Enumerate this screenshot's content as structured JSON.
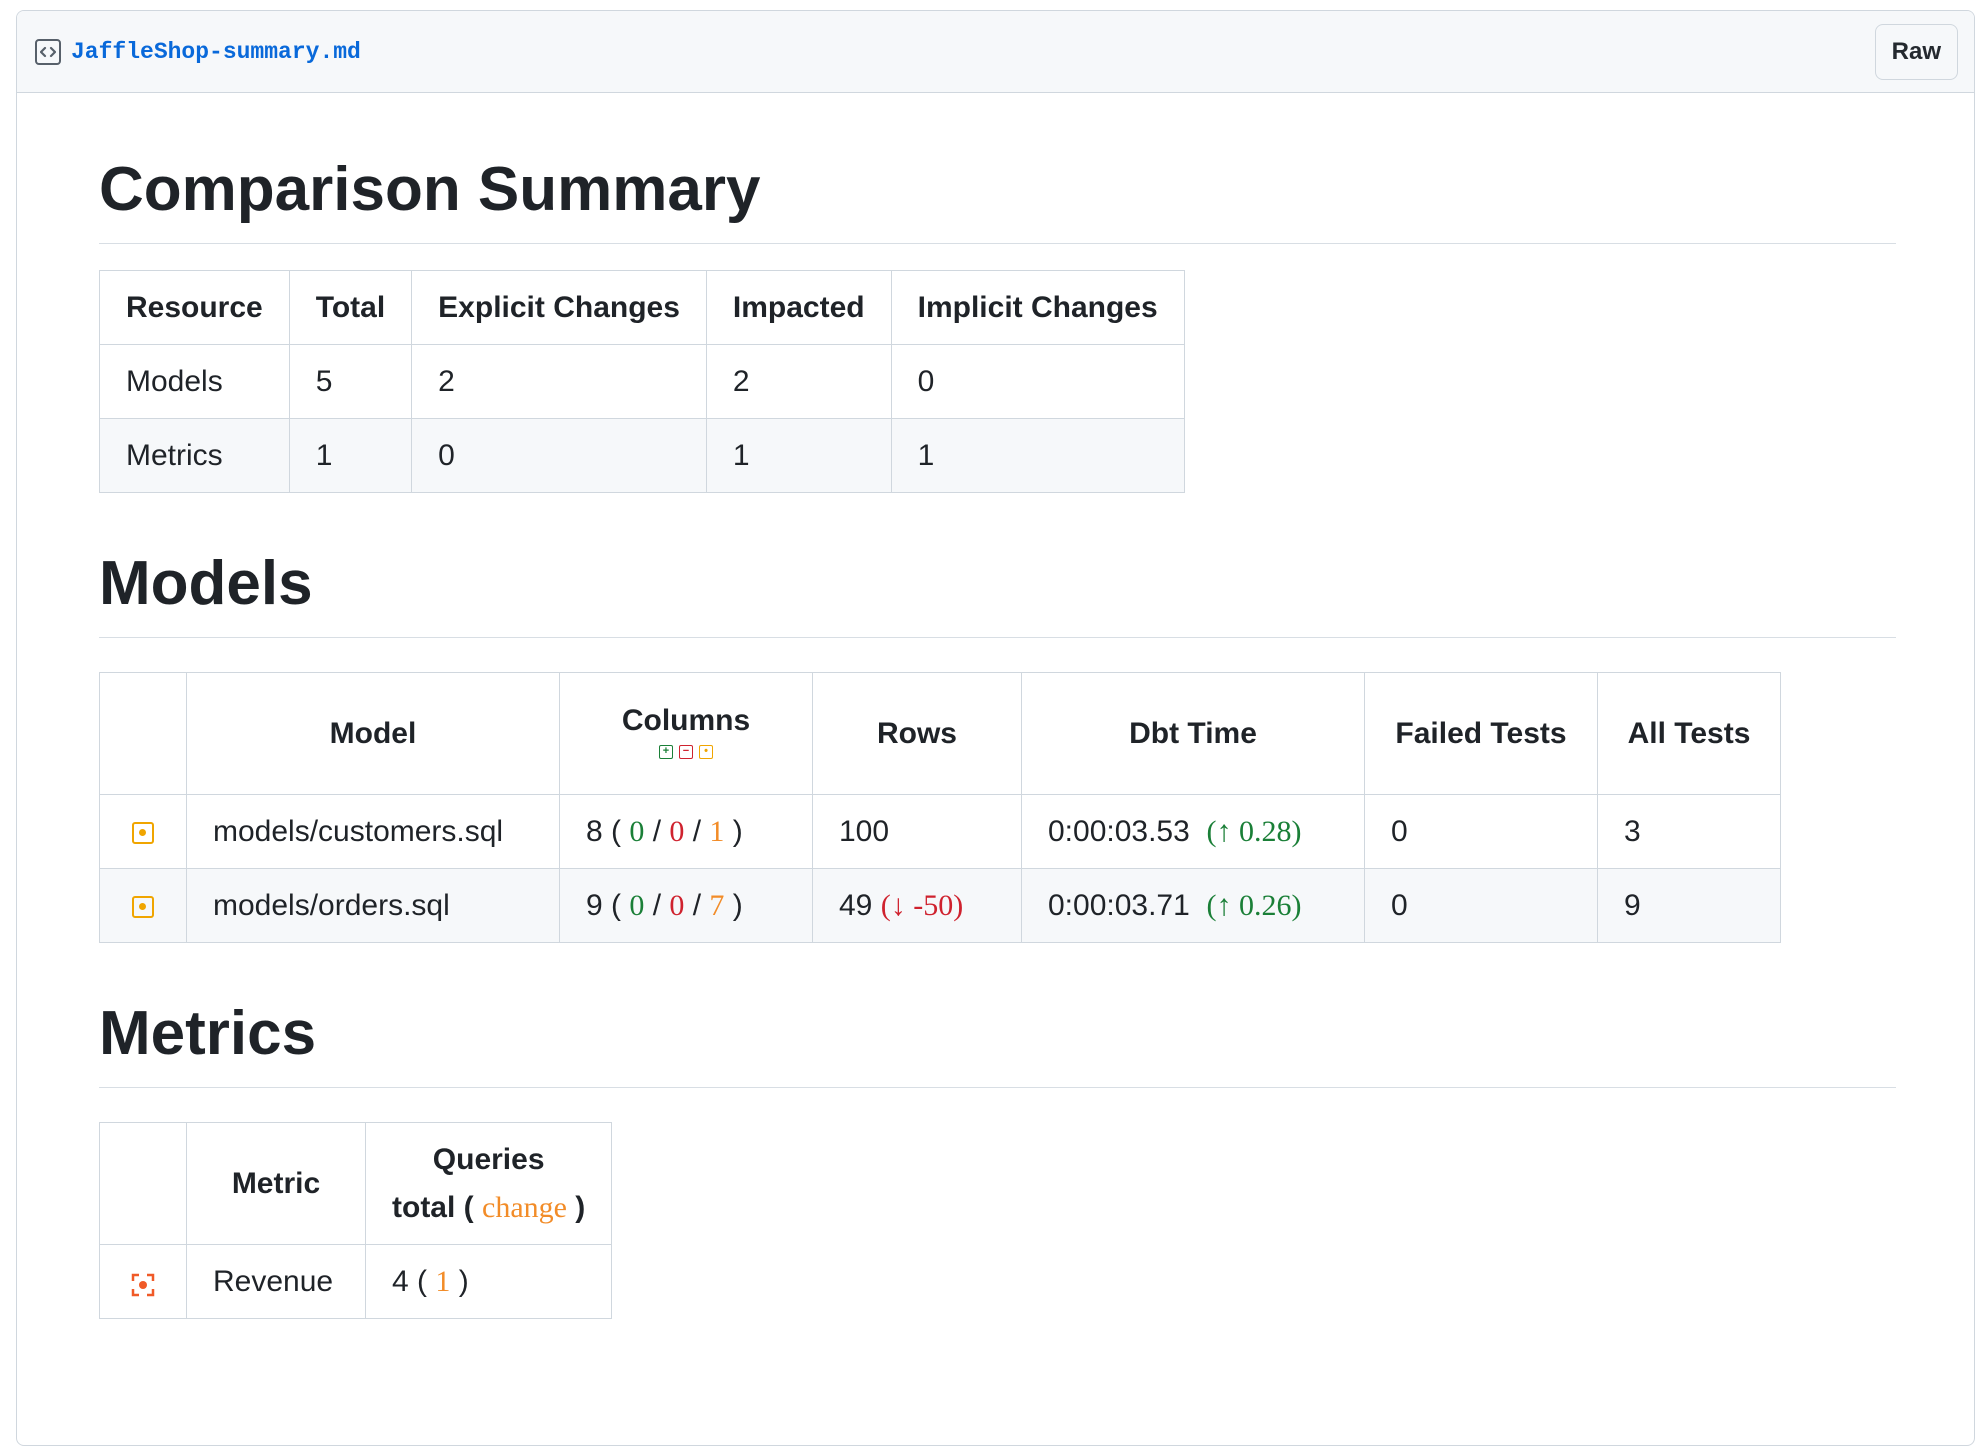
{
  "file": {
    "filename": "JaffleShop-summary.md",
    "raw_label": "Raw"
  },
  "summary": {
    "title": "Comparison Summary",
    "headers": [
      "Resource",
      "Total",
      "Explicit Changes",
      "Impacted",
      "Implicit Changes"
    ],
    "rows": [
      [
        "Models",
        "5",
        "2",
        "2",
        "0"
      ],
      [
        "Metrics",
        "1",
        "0",
        "1",
        "1"
      ]
    ]
  },
  "models": {
    "title": "Models",
    "headers": {
      "model": "Model",
      "columns": "Columns",
      "rows": "Rows",
      "dbt_time": "Dbt Time",
      "failed_tests": "Failed Tests",
      "all_tests": "All Tests"
    },
    "column_legend_icons": [
      "added-icon",
      "removed-icon",
      "changed-icon"
    ],
    "rows": [
      {
        "status_icon": "changed-icon",
        "model": "models/customers.sql",
        "columns_total": "8",
        "added": "0",
        "removed": "0",
        "changed": "1",
        "rows": "100",
        "rows_delta": "",
        "dbt_time": "0:00:03.53",
        "dbt_time_delta": "(↑ 0.28)",
        "failed_tests": "0",
        "all_tests": "3"
      },
      {
        "status_icon": "changed-icon",
        "model": "models/orders.sql",
        "columns_total": "9",
        "added": "0",
        "removed": "0",
        "changed": "7",
        "rows": "49",
        "rows_delta": "(↓ -50)",
        "dbt_time": "0:00:03.71",
        "dbt_time_delta": "(↑ 0.26)",
        "failed_tests": "0",
        "all_tests": "9"
      }
    ]
  },
  "metrics": {
    "title": "Metrics",
    "headers": {
      "metric": "Metric",
      "queries": "Queries",
      "total_label": "total (",
      "change_label": "change",
      "close_paren": ")"
    },
    "rows": [
      {
        "status_icon": "impacted-icon",
        "metric": "Revenue",
        "total": "4",
        "change": "1"
      }
    ]
  },
  "colors": {
    "link": "#0969da",
    "added": "#1a7f37",
    "removed": "#cf222e",
    "changed": "#f28c28",
    "impacted": "#f05a28",
    "border": "#d0d7de"
  }
}
